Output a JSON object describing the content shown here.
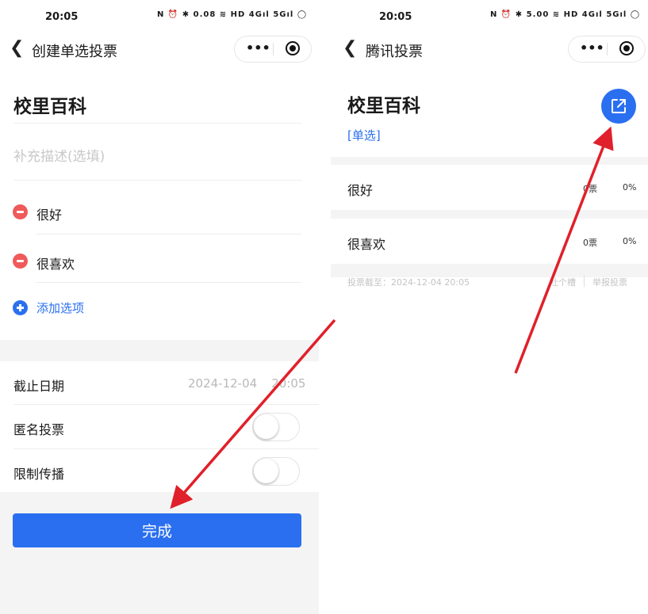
{
  "left": {
    "status": {
      "time": "20:05",
      "icons": "N ⏰ ✱ 0.08 ≋ HD 4Gıl 5Gıl ◯"
    },
    "nav": {
      "title": "创建单选投票"
    },
    "poll": {
      "title": "校里百科",
      "desc_placeholder": "补充描述(选填)",
      "options": [
        {
          "label": "很好"
        },
        {
          "label": "很喜欢"
        }
      ],
      "add_label": "添加选项"
    },
    "settings": {
      "deadline_label": "截止日期",
      "deadline_date": "2024-12-04",
      "deadline_time": "20:05",
      "anonymous_label": "匿名投票",
      "anonymous_on": false,
      "restrict_label": "限制传播",
      "restrict_on": false
    },
    "done_label": "完成"
  },
  "right": {
    "status": {
      "time": "20:05",
      "icons": "N ⏰ ✱ 5.00 ≋ HD 4Gıl 5Gıl ◯"
    },
    "nav": {
      "title": "腾讯投票"
    },
    "poll": {
      "title": "校里百科",
      "type_tag": "[单选]",
      "options": [
        {
          "label": "很好",
          "votes": "0票",
          "percent": "0%"
        },
        {
          "label": "很喜欢",
          "votes": "0票",
          "percent": "0%"
        }
      ],
      "deadline_text": "投票截至：2024-12-04 20:05",
      "complaint_link": "吐个槽",
      "report_link": "举报投票"
    }
  },
  "colors": {
    "accent": "#2a6ff0",
    "remove": "#f05a5a",
    "annotation": "#e0202a"
  }
}
